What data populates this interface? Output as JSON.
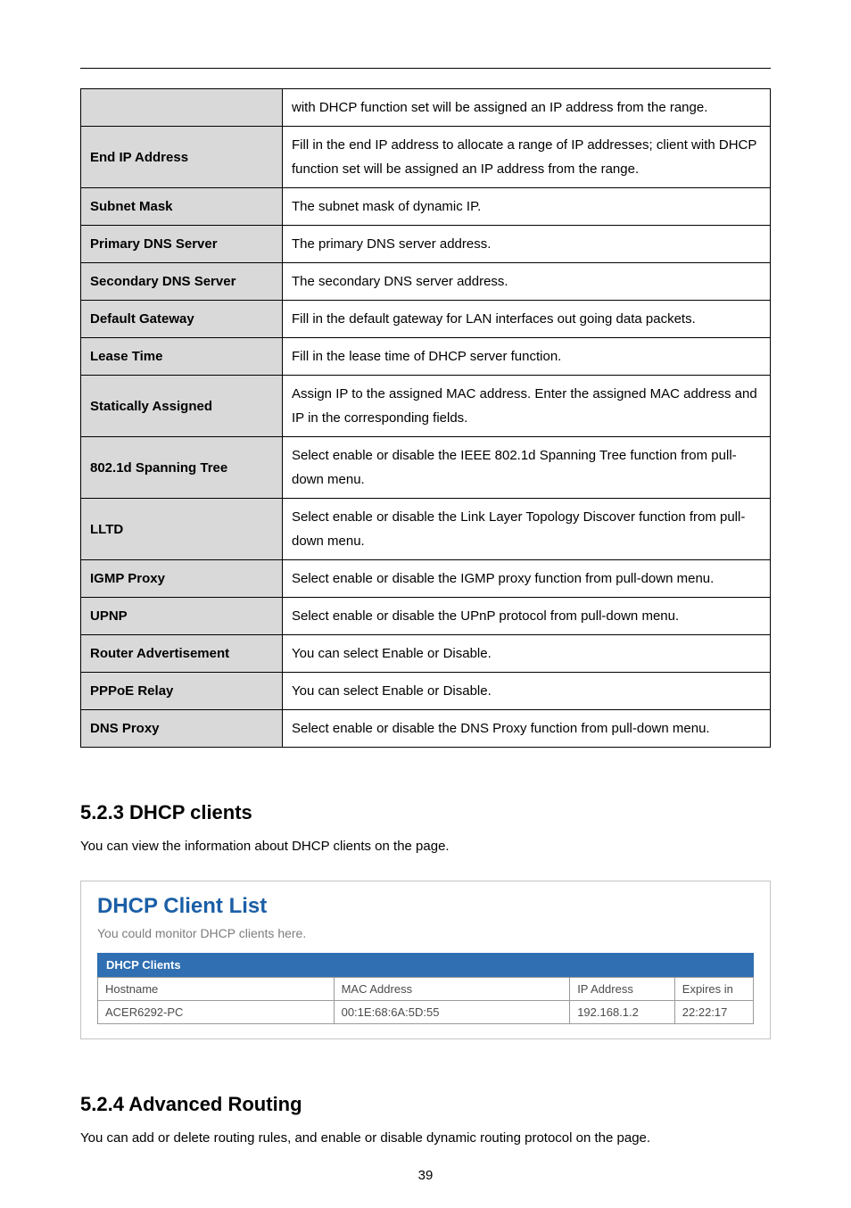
{
  "defs": {
    "blankRowText": "with DHCP function set will be assigned an IP address from the range.",
    "rows": [
      {
        "label": "End IP Address",
        "desc": "Fill in the end IP address to allocate a range of IP addresses; client with DHCP function set will be assigned an IP address from the range."
      },
      {
        "label": "Subnet Mask",
        "desc": "The subnet mask of dynamic IP."
      },
      {
        "label": "Primary DNS Server",
        "desc": "The primary DNS server address."
      },
      {
        "label": "Secondary DNS Server",
        "desc": "The secondary DNS server address."
      },
      {
        "label": "Default Gateway",
        "desc": "Fill in the default gateway for LAN interfaces out going data packets."
      },
      {
        "label": "Lease Time",
        "desc": "Fill in the lease time of DHCP server function."
      },
      {
        "label": "Statically Assigned",
        "desc": "Assign IP to the assigned MAC address. Enter the assigned MAC address and IP in the corresponding fields."
      },
      {
        "label": "802.1d Spanning Tree",
        "desc": "Select enable or disable the IEEE 802.1d Spanning Tree function from pull-down menu."
      },
      {
        "label": "LLTD",
        "desc": "Select enable or disable the Link Layer Topology Discover function from pull-down menu."
      },
      {
        "label": "IGMP Proxy",
        "desc": "Select enable or disable the IGMP proxy function from pull-down menu."
      },
      {
        "label": "UPNP",
        "desc": "Select enable or disable the UPnP protocol from pull-down menu."
      },
      {
        "label": "Router Advertisement",
        "desc": "You can select Enable or Disable."
      },
      {
        "label": "PPPoE Relay",
        "desc": "You can select Enable or Disable."
      },
      {
        "label": "DNS Proxy",
        "desc": "Select enable or disable the DNS Proxy function from pull-down menu."
      }
    ]
  },
  "sections": {
    "dhcpClients": {
      "heading": "5.2.3 DHCP clients",
      "intro": "You can view the information about DHCP clients on the page."
    },
    "advancedRouting": {
      "heading": "5.2.4 Advanced Routing",
      "intro": "You can add or delete routing rules, and enable or disable dynamic routing protocol on the page."
    }
  },
  "dhcpPanel": {
    "title": "DHCP Client List",
    "subtitle": "You could monitor DHCP clients here.",
    "sectionBar": "DHCP Clients",
    "headers": {
      "hostname": "Hostname",
      "mac": "MAC Address",
      "ip": "IP Address",
      "expires": "Expires in"
    },
    "rows": [
      {
        "hostname": "ACER6292-PC",
        "mac": "00:1E:68:6A:5D:55",
        "ip": "192.168.1.2",
        "expires": "22:22:17"
      }
    ]
  },
  "pageNumber": "39"
}
